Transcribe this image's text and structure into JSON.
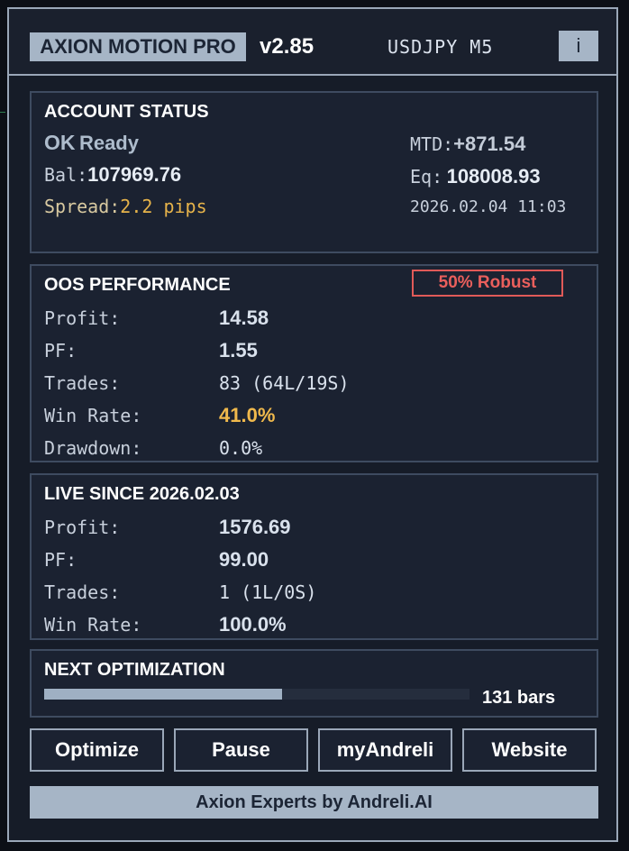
{
  "header": {
    "app_name": "AXION MOTION PRO",
    "version": "v2.85",
    "symbol": "USDJPY M5",
    "info_label": "i"
  },
  "account": {
    "title": "ACCOUNT STATUS",
    "status_ok": "OK",
    "status_text": "Ready",
    "mtd_label": "MTD:",
    "mtd_value": "+871.54",
    "bal_label": "Bal:",
    "bal_value": "107969.76",
    "eq_label": "Eq:",
    "eq_value": "108008.93",
    "spread_label": "Spread:",
    "spread_value": "2.2 pips",
    "datetime": "2026.02.04 11:03"
  },
  "oos": {
    "title": "OOS PERFORMANCE",
    "badge": "50% Robust",
    "rows": [
      {
        "label": "Profit:",
        "value": "14.58"
      },
      {
        "label": "PF:",
        "value": "1.55"
      },
      {
        "label": "Trades:",
        "value": "83 (64L/19S)"
      },
      {
        "label": "Win Rate:",
        "value": "41.0%"
      },
      {
        "label": "Drawdown:",
        "value": "0.0%"
      }
    ]
  },
  "live": {
    "title": "LIVE SINCE 2026.02.03",
    "rows": [
      {
        "label": "Profit:",
        "value": "1576.69"
      },
      {
        "label": "PF:",
        "value": "99.00"
      },
      {
        "label": "Trades:",
        "value": "1 (1L/0S)"
      },
      {
        "label": "Win Rate:",
        "value": "100.0%"
      }
    ]
  },
  "optimization": {
    "title": "NEXT OPTIMIZATION",
    "bars_text": "131 bars",
    "progress_fraction": 0.56
  },
  "buttons": {
    "optimize": "Optimize",
    "pause": "Pause",
    "my_andreli": "myAndreli",
    "website": "Website"
  },
  "footer": {
    "text": "Axion Experts by Andreli.AI"
  },
  "colors": {
    "accent_panel": "#a6b5c6",
    "spread": "#e6b34a",
    "win_rate_oos": "#f0b94c",
    "robust_badge": "#ea5f5c"
  }
}
